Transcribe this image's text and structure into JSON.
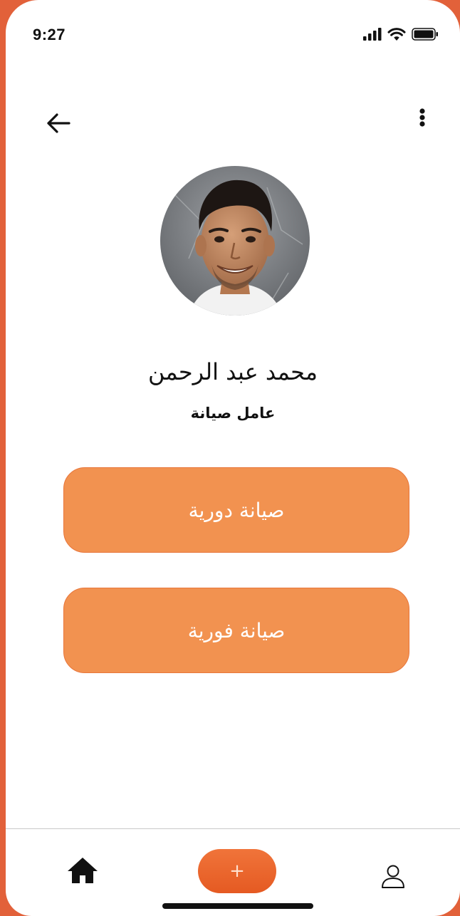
{
  "status_bar": {
    "time": "9:27"
  },
  "profile": {
    "name": "محمد عبد الرحمن",
    "role": "عامل صيانة"
  },
  "actions": {
    "periodic_label": "صيانة دورية",
    "urgent_label": "صيانة فورية"
  },
  "bottom_nav": {
    "add_label": "+"
  },
  "colors": {
    "frame": "#E2613A",
    "button_fill": "#F29250",
    "button_border": "#E8763B",
    "fab": "#EB6530"
  },
  "icons": {
    "back": "arrow-left-icon",
    "more": "vertical-dots-icon",
    "home": "home-icon",
    "profile": "user-icon"
  }
}
